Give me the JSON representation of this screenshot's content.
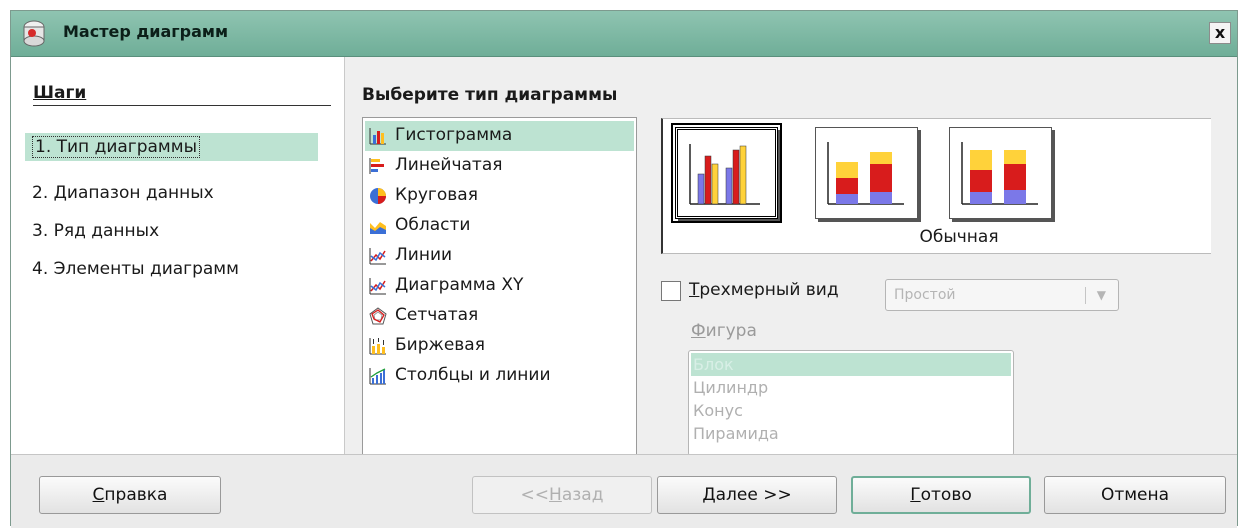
{
  "window": {
    "title": "Мастер диаграмм",
    "close_symbol": "x"
  },
  "steps": {
    "title": "Шаги",
    "items": [
      {
        "label": "1. Тип диаграммы",
        "active": true
      },
      {
        "label": "2. Диапазон данных",
        "active": false
      },
      {
        "label": "3. Ряд данных",
        "active": false
      },
      {
        "label": "4. Элементы диаграмм",
        "active": false
      }
    ]
  },
  "chart_type": {
    "title": "Выберите тип диаграммы",
    "items": [
      {
        "label": "Гистограмма",
        "icon": "column-chart-icon",
        "selected": true
      },
      {
        "label": "Линейчатая",
        "icon": "bar-chart-icon"
      },
      {
        "label": "Круговая",
        "icon": "pie-chart-icon"
      },
      {
        "label": "Области",
        "icon": "area-chart-icon"
      },
      {
        "label": "Линии",
        "icon": "line-chart-icon"
      },
      {
        "label": "Диаграмма XY",
        "icon": "xy-chart-icon"
      },
      {
        "label": "Сетчатая",
        "icon": "net-chart-icon"
      },
      {
        "label": "Биржевая",
        "icon": "stock-chart-icon"
      },
      {
        "label": "Столбцы и линии",
        "icon": "column-line-chart-icon"
      }
    ]
  },
  "variants": {
    "caption": "Обычная",
    "items": [
      {
        "name": "normal",
        "selected": true
      },
      {
        "name": "stacked",
        "selected": false
      },
      {
        "name": "percent-stacked",
        "selected": false
      }
    ]
  },
  "options": {
    "three_d_label_first": "Т",
    "three_d_label_rest": "рехмерный вид",
    "three_d_checked": false,
    "scheme_value": "Простой",
    "figure_label_first": "Ф",
    "figure_label_rest": "игура",
    "figures": [
      {
        "label": "Блок",
        "selected": true
      },
      {
        "label": "Цилиндр",
        "selected": false
      },
      {
        "label": "Конус",
        "selected": false
      },
      {
        "label": "Пирамида",
        "selected": false
      }
    ]
  },
  "buttons": {
    "help_first": "С",
    "help_rest": "правка",
    "back_prefix": "<<",
    "back_first": "Н",
    "back_rest": "азад",
    "next_first": "Д",
    "next_rest": "алее >>",
    "finish_first": "Г",
    "finish_rest": "отово",
    "cancel": "Отмена"
  },
  "colors": {
    "accent": "#6fae98",
    "selection": "#bde3d2",
    "bar_blue": "#7b78e8",
    "bar_red": "#d81c1c",
    "bar_yellow": "#ffd23a"
  }
}
